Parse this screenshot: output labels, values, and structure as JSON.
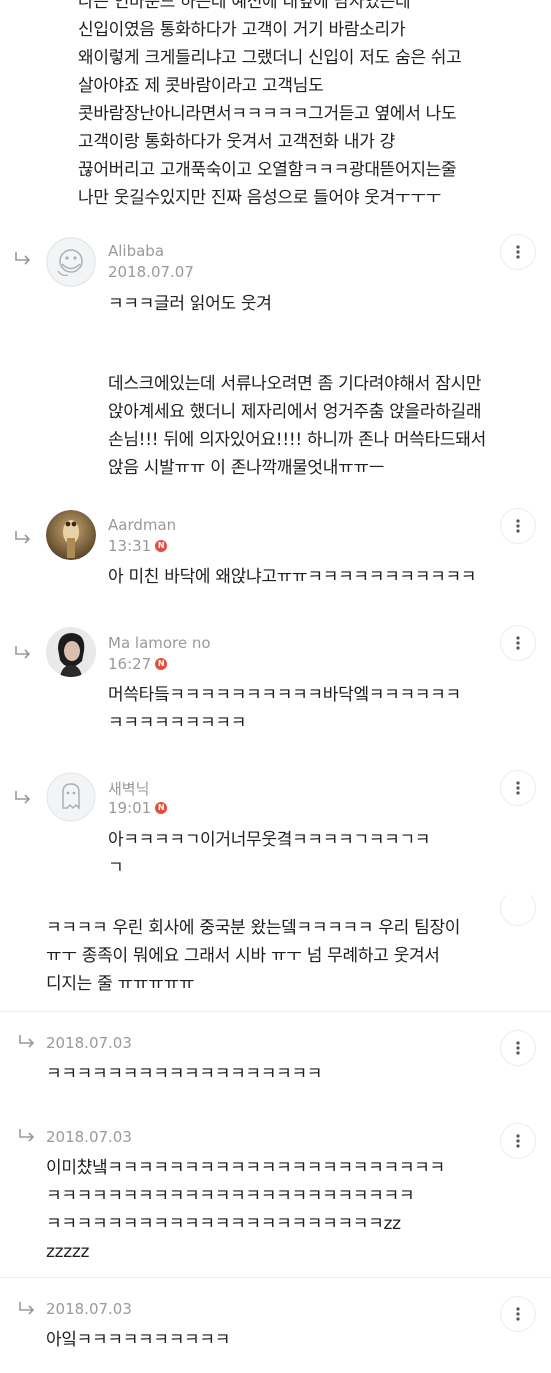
{
  "top_comment": {
    "text": "나는 인바운드 하는데 예전에 내옆에 남자였는데\n신입이였음 통화하다가 고객이 거기 바람소리가\n왜이렇게 크게들리냐고 그랬더니 신입이 저도 숨은 쉬고\n살아야죠 제 콧바람이라고 고객님도\n콧바람장난아니라면서ㅋㅋㅋㅋㅋ그거듣고 옆에서 나도\n고객이랑 통화하다가 웃겨서 고객전화 내가 걍\n끊어버리고 고개푹숙이고 오열함ㅋㅋㅋ광대뜯어지는줄\n나만 웃길수있지만 진짜 음성으로 들어야 웃겨ㅜㅜㅜ"
  },
  "comments": [
    {
      "username": "Alibaba",
      "date": "2018.07.07",
      "new": false,
      "text": "ㅋㅋㅋ글러 읽어도 웃겨",
      "avatar_icon": "alibaba-avatar-icon"
    },
    {
      "username": "",
      "date": "",
      "new": false,
      "text": "데스크에있는데 서류나오려면 좀 기다려야해서 잠시만\n앉아계세요 했더니 제자리에서 엉거주춤 앉을라하길래\n손님!!! 뒤에 의자있어요!!!! 하니까 존나 머쓱타드돼서\n앉음 시발ㅠㅠ 이 존나깍깨물엇내ㅠㅠㅡ"
    },
    {
      "username": "Aardman",
      "date": "13:31",
      "new": true,
      "badge": "N",
      "text": "아 미친 바닥에 왜앉냐고ㅠㅠㅋㅋㅋㅋㅋㅋㅋㅋㅋㅋㅋ",
      "avatar_icon": "aardman-avatar-icon"
    },
    {
      "username": "Ma lamore no",
      "date": "16:27",
      "new": true,
      "badge": "N",
      "text": "머쓱타듴ㅋㅋㅋㅋㅋㅋㅋㅋㅋㅋ바닥엨ㅋㅋㅋㅋㅋㅋ\nㅋㅋㅋㅋㅋㅋㅋㅋㅋ",
      "avatar_icon": "portrait-avatar-icon"
    },
    {
      "username": "새벽닉",
      "date": "19:01",
      "new": true,
      "badge": "N",
      "text": "아ㅋㅋㅋㅋㄱ이거너무웃곀ㅋㅋㅋㅋㄱㅋㅋㄱㅋ\nㄱ",
      "avatar_icon": "ghost-avatar-icon"
    }
  ],
  "second_thread": {
    "text": "ㅋㅋㅋㅋ 우린 회사에 중국분 왔는뎈ㅋㅋㅋㅋㅋ 우리 팀장이\nㅠㅜ 종족이 뭐에요 그래서 시바 ㅠㅜ 넘 무례하고 웃겨서\n디지는 줄 ㅠㅠㅠㅠㅠ",
    "replies": [
      {
        "date": "2018.07.03",
        "text": "ㅋㅋㅋㅋㅋㅋㅋㅋㅋㅋㅋㅋㅋㅋㅋㅋㅋㅋ"
      },
      {
        "date": "2018.07.03",
        "text": "이미챴냌ㅋㅋㅋㅋㅋㅋㅋㅋㅋㅋㅋㅋㅋㅋㅋㅋㅋㅋㅋㅋㅋㅋ\nㅋㅋㅋㅋㅋㅋㅋㅋㅋㅋㅋㅋㅋㅋㅋㅋㅋㅋㅋㅋㅋㅋㅋㅋ\nㅋㅋㅋㅋㅋㅋㅋㅋㅋㅋㅋㅋㅋㅋㅋㅋㅋㅋㅋㅋㅋㅋzz\nzzzzz"
      },
      {
        "date": "2018.07.03",
        "text": "아잌ㅋㅋㅋㅋㅋㅋㅋㅋㅋㅋ"
      }
    ]
  },
  "icons": {
    "reply": "reply-arrow-icon",
    "more": "more-vertical-icon"
  },
  "colors": {
    "meta_gray": "#9a9a9a",
    "badge_red": "#e74c3c",
    "divider": "#ececec"
  }
}
